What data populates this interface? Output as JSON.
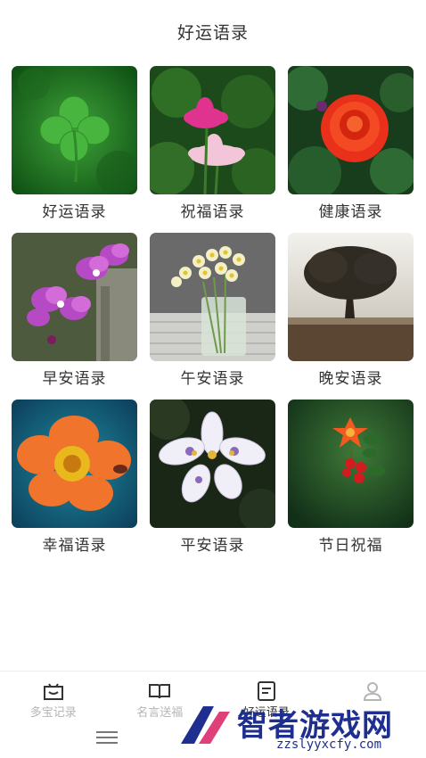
{
  "header": {
    "title": "好运语录"
  },
  "categories": [
    {
      "label": "好运语录",
      "image": "four-leaf-clover"
    },
    {
      "label": "祝福语录",
      "image": "lotus-flowers"
    },
    {
      "label": "健康语录",
      "image": "red-rose"
    },
    {
      "label": "早安语录",
      "image": "orchid"
    },
    {
      "label": "午安语录",
      "image": "narcissus-vase"
    },
    {
      "label": "晚安语录",
      "image": "lone-tree"
    },
    {
      "label": "幸福语录",
      "image": "orange-flower"
    },
    {
      "label": "平安语录",
      "image": "white-iris"
    },
    {
      "label": "节日祝福",
      "image": "pomegranate-blossom"
    }
  ],
  "tabbar": {
    "items": [
      {
        "label": "多宝记录",
        "icon": "basket-icon",
        "active": false
      },
      {
        "label": "名言送福",
        "icon": "book-icon",
        "active": false
      },
      {
        "label": "好运语录",
        "icon": "note-icon",
        "active": true
      },
      {
        "label": "",
        "icon": "profile-icon",
        "active": false
      }
    ]
  },
  "watermark": {
    "brand": "智者游戏网",
    "url": "zzslyyxcfy.com"
  }
}
